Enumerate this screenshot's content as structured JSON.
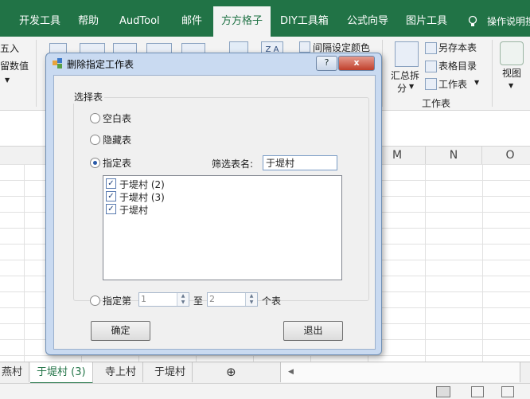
{
  "ribbon_tabs": [
    {
      "label": "开发工具"
    },
    {
      "label": "帮助"
    },
    {
      "label": "AudTool"
    },
    {
      "label": "邮件"
    },
    {
      "label": "方方格子"
    },
    {
      "label": "DIY工具箱"
    },
    {
      "label": "公式向导"
    },
    {
      "label": "图片工具"
    }
  ],
  "tell_me": "操作说明搜",
  "ribbon": {
    "left_line1": "五入",
    "left_line2": "留数值",
    "interval_color": "间隔设定颜色",
    "summary_split": "汇总拆",
    "summary_split2": "分",
    "save_as_sheet": "另存本表",
    "sheet_directory": "表格目录",
    "worksheet": "工作表",
    "group_worksheet": "工作表",
    "view": "视图"
  },
  "columns": [
    "M",
    "N",
    "O"
  ],
  "sheet_tabs": [
    "燕村",
    "于堤村 (3)",
    "寺上村",
    "于堤村"
  ],
  "dialog": {
    "title": "删除指定工作表",
    "help_btn": "?",
    "close_btn": "x",
    "group_label": "选择表",
    "opt_blank": "空白表",
    "opt_hidden": "隐藏表",
    "opt_specified": "指定表",
    "filter_label": "筛选表名:",
    "filter_value": "于堤村",
    "list": [
      {
        "label": "于堤村 (2)",
        "checked": true
      },
      {
        "label": "于堤村 (3)",
        "checked": true
      },
      {
        "label": "于堤村",
        "checked": true
      }
    ],
    "opt_range": "指定第",
    "range_from": "1",
    "range_to_label": "至",
    "range_to": "2",
    "range_unit": "个表",
    "ok": "确定",
    "exit": "退出"
  }
}
